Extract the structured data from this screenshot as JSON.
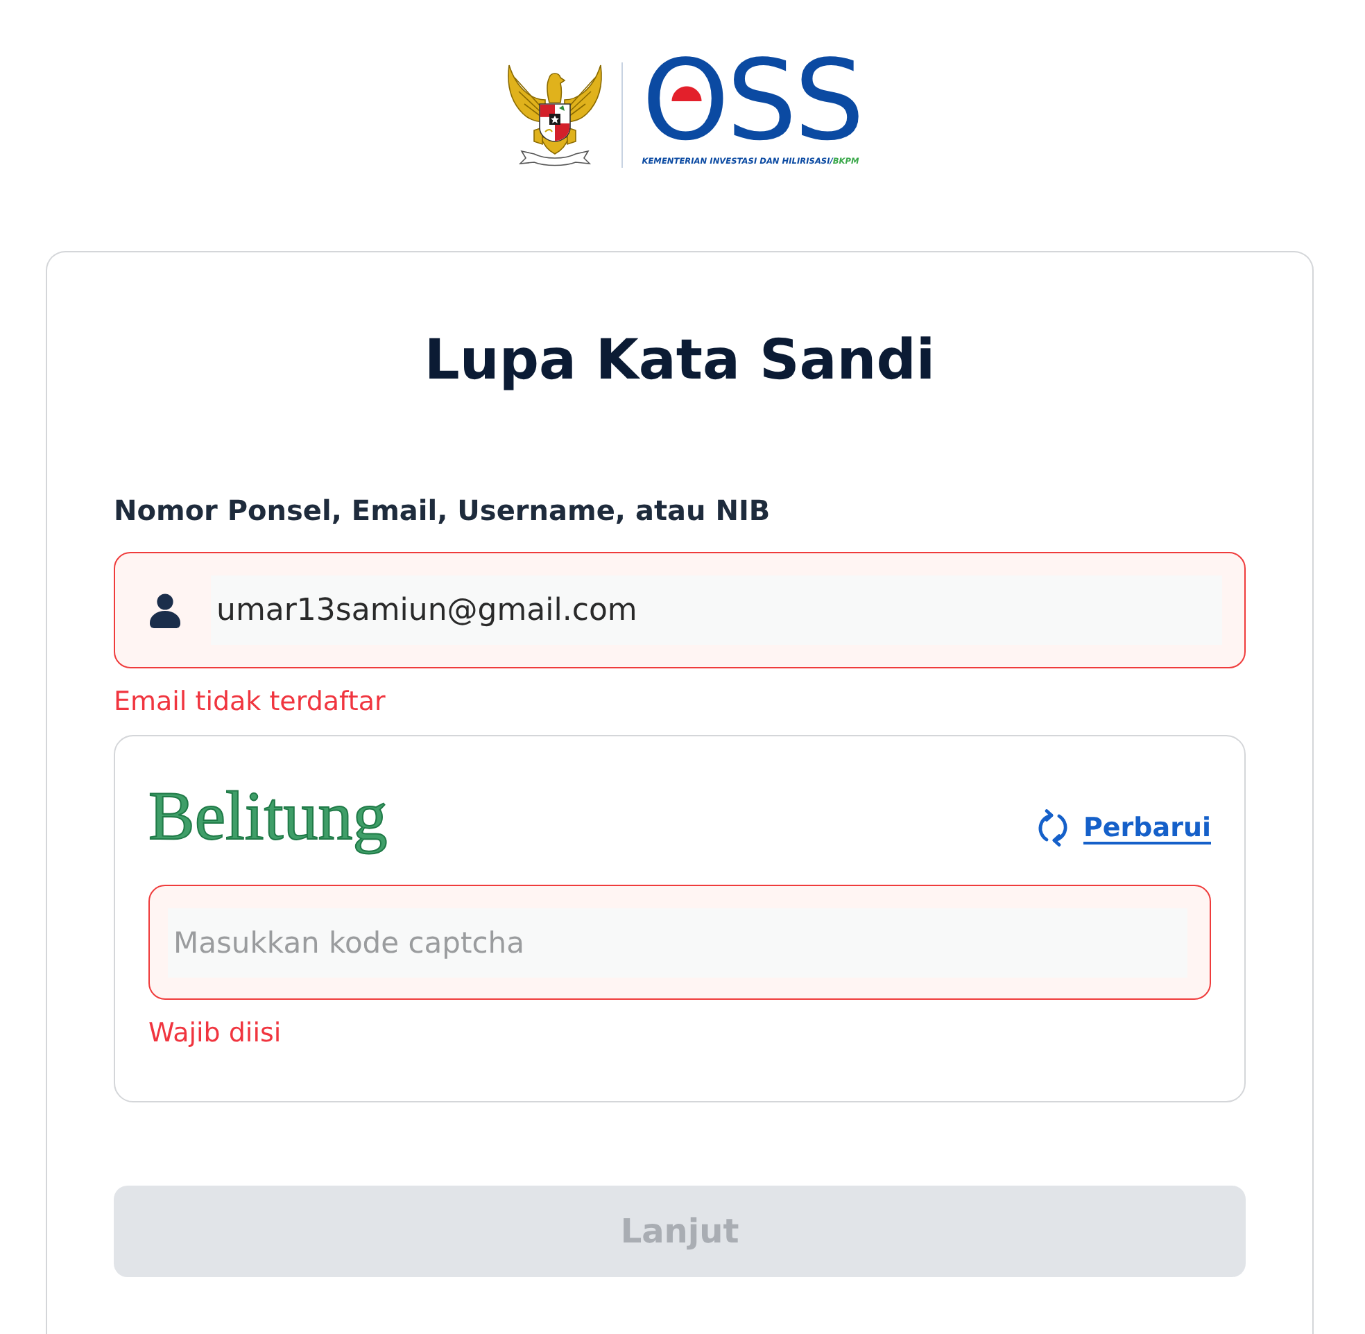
{
  "header": {
    "logo_text": "OSS",
    "ministry": "KEMENTERIAN INVESTASI DAN HILIRISASI/",
    "agency": "BKPM"
  },
  "title": "Lupa Kata Sandi",
  "identifier_field": {
    "label": "Nomor Ponsel, Email, Username, atau NIB",
    "value": "umar13samiun@gmail.com",
    "error": "Email tidak terdaftar"
  },
  "captcha": {
    "challenge": "Belitung",
    "refresh_link": "Perbarui",
    "input": {
      "placeholder": "Masukkan kode captcha",
      "error": "Wajib diisi"
    }
  },
  "submit_button": {
    "label": "Lanjut",
    "disabled": true
  }
}
